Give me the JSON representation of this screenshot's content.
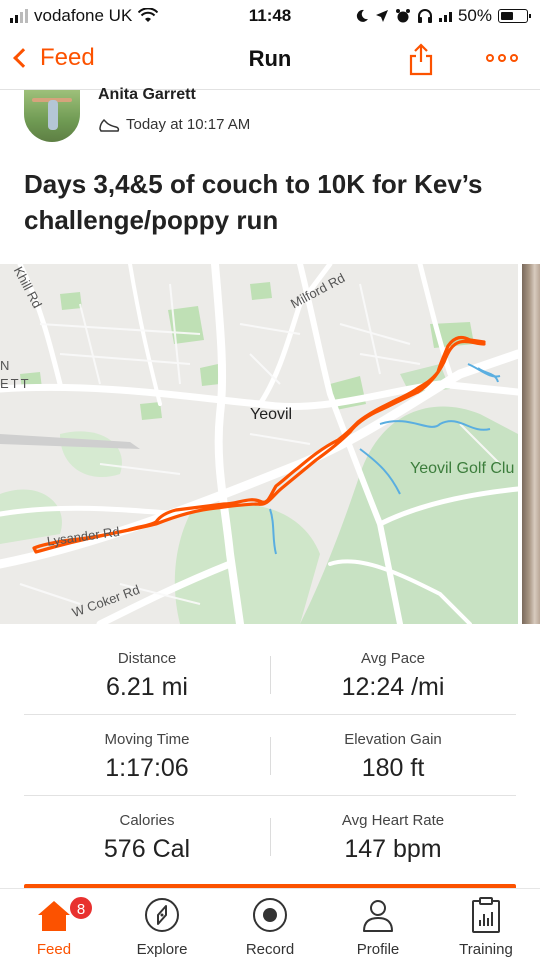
{
  "status_bar": {
    "carrier": "vodafone UK",
    "time": "11:48",
    "battery": "50%"
  },
  "nav": {
    "back_label": "Feed",
    "title": "Run"
  },
  "author": {
    "name": "Anita Garrett",
    "timestamp": "Today at 10:17 AM"
  },
  "activity": {
    "title": "Days 3,4&5 of couch to 10K for Kev’s challenge/poppy run"
  },
  "map": {
    "labels": {
      "town": "Yeovil",
      "golf": "Yeovil Golf Clu",
      "milford": "Milford Rd",
      "coker": "W Coker Rd",
      "lysander": "Lysander Rd",
      "khill": "Khill Rd",
      "left_edge_top": "N",
      "left_edge_bottom": "ETT"
    },
    "route_color": "#fc5200"
  },
  "stats": [
    {
      "label": "Distance",
      "value": "6.21 mi"
    },
    {
      "label": "Avg Pace",
      "value": "12:24 /mi"
    },
    {
      "label": "Moving Time",
      "value": "1:17:06"
    },
    {
      "label": "Elevation Gain",
      "value": "180 ft"
    },
    {
      "label": "Calories",
      "value": "576 Cal"
    },
    {
      "label": "Avg Heart Rate",
      "value": "147 bpm"
    }
  ],
  "tabs": [
    {
      "label": "Feed",
      "icon": "home-icon",
      "active": true,
      "badge": "8"
    },
    {
      "label": "Explore",
      "icon": "compass-icon"
    },
    {
      "label": "Record",
      "icon": "record-icon"
    },
    {
      "label": "Profile",
      "icon": "person-icon"
    },
    {
      "label": "Training",
      "icon": "training-chart-icon"
    }
  ],
  "colors": {
    "accent": "#fc5200",
    "badge": "#e8312f"
  }
}
